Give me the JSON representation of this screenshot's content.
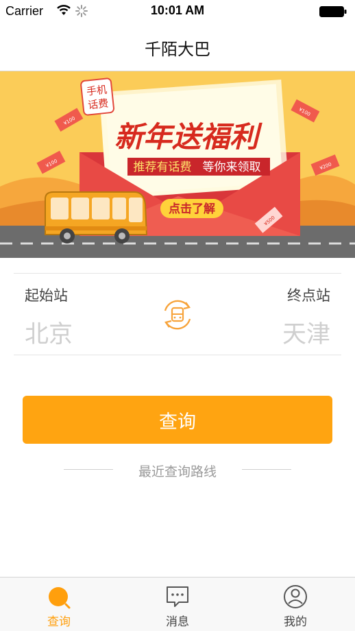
{
  "status_bar": {
    "carrier": "Carrier",
    "time": "10:01 AM"
  },
  "nav": {
    "title": "千陌大巴"
  },
  "banner": {
    "badge_line1": "手机",
    "badge_line2": "话费",
    "headline": "新年送福利",
    "subline_left": "推荐有话费",
    "subline_right": "等你来领取",
    "cta": "点击了解",
    "bill_100a": "¥100",
    "bill_100b": "¥100",
    "bill_100c": "¥100",
    "bill_200": "¥200",
    "bill_500": "¥500"
  },
  "form": {
    "origin_label": "起始站",
    "origin_value": "北京",
    "dest_label": "终点站",
    "dest_value": "天津"
  },
  "search_button": {
    "label": "查询"
  },
  "recent": {
    "label": "最近查询路线"
  },
  "tabs": [
    {
      "label": "查询",
      "icon": "search-icon",
      "active": true
    },
    {
      "label": "消息",
      "icon": "message-icon",
      "active": false
    },
    {
      "label": "我的",
      "icon": "profile-icon",
      "active": false
    }
  ],
  "colors": {
    "accent": "#ffa411",
    "banner_sky": "#fbcc58",
    "envelope": "#e0393a"
  }
}
